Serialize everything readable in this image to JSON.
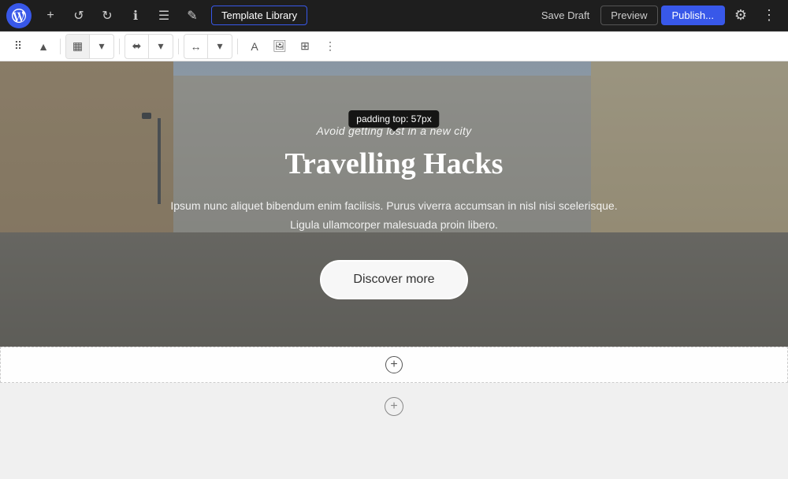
{
  "toolbar": {
    "wp_logo_alt": "WordPress",
    "add_btn": "+",
    "undo_btn": "↺",
    "redo_btn": "↻",
    "info_btn": "ℹ",
    "list_btn": "☰",
    "edit_btn": "✎",
    "template_library_label": "Template Library",
    "save_draft_label": "Save Draft",
    "preview_label": "Preview",
    "publish_label": "Publish...",
    "settings_icon": "⚙",
    "more_icon": "⋮"
  },
  "second_toolbar": {
    "drag_icon": "⋮⋮",
    "select_parent_icon": "↑",
    "block_view_icon": "▦",
    "block_view_arrow": "▾",
    "align_icon": "⬌",
    "align_arrow": "▾",
    "wide_icon": "↔",
    "wide_arrow": "▾",
    "color_icon": "A",
    "image_icon": "🖼",
    "block_icon": "▣",
    "more_icon": "⋮"
  },
  "padding_tooltip": {
    "text": "padding top: 57px",
    "cursor_icon": "↕"
  },
  "hero": {
    "subtitle": "Avoid getting lost in a new city",
    "title": "Travelling Hacks",
    "body": "Ipsum nunc aliquet bibendum enim facilisis. Purus viverra accumsan in nisl nisi scelerisque. Ligula ullamcorper malesuada proin libero.",
    "button_label": "Discover more"
  },
  "add_block": {
    "icon": "+"
  },
  "bottom": {
    "add_icon": "+"
  }
}
